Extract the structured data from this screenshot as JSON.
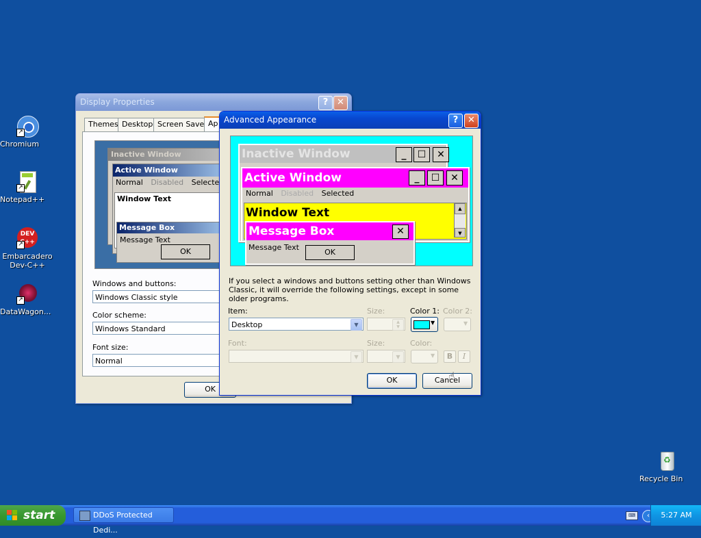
{
  "desktop_icons": [
    {
      "label": "Chromium",
      "icon": "chromium-icon"
    },
    {
      "label": "Notepad++",
      "icon": "notepadpp-icon"
    },
    {
      "label": "Embarcadero Dev-C++",
      "icon": "devcpp-icon"
    },
    {
      "label": "DataWagon...",
      "icon": "datawagon-icon"
    },
    {
      "label": "Recycle Bin",
      "icon": "recycle-bin-icon"
    }
  ],
  "display_properties": {
    "title": "Display Properties",
    "tabs": [
      "Themes",
      "Desktop",
      "Screen Saver",
      "Ap"
    ],
    "preview": {
      "inactive_title": "Inactive Window",
      "active_title": "Active Window",
      "menu": [
        "Normal",
        "Disabled",
        "Selected"
      ],
      "window_text": "Window Text",
      "msgbox_title": "Message Box",
      "msgbox_text": "Message Text",
      "ok": "OK"
    },
    "windows_buttons_label": "Windows and buttons:",
    "windows_buttons_value": "Windows Classic style",
    "color_scheme_label": "Color scheme:",
    "color_scheme_value": "Windows Standard",
    "font_size_label": "Font size:",
    "font_size_value": "Normal",
    "ok_button": "OK"
  },
  "advanced_appearance": {
    "title": "Advanced Appearance",
    "preview": {
      "inactive_title": "Inactive Window",
      "active_title": "Active Window",
      "menu": [
        "Normal",
        "Disabled",
        "Selected"
      ],
      "window_text": "Window Text",
      "msgbox_title": "Message Box",
      "msgbox_text": "Message Text",
      "ok": "OK"
    },
    "note": "If you select a windows and buttons setting other than Windows Classic, it will override the following settings, except in some older programs.",
    "item_label": "Item:",
    "item_value": "Desktop",
    "size_label": "Size:",
    "color1_label": "Color 1:",
    "color2_label": "Color 2:",
    "font_label": "Font:",
    "font_size_label": "Size:",
    "font_color_label": "Color:",
    "bold_label": "B",
    "italic_label": "I",
    "ok_button": "OK",
    "cancel_button": "Cancel",
    "color1_swatch": "#00ffff"
  },
  "taskbar": {
    "start_label": "start",
    "task_label": "DDoS Protected Dedi...",
    "clock": "5:27 AM"
  },
  "colors": {
    "desktop": "#0f4f9f",
    "preview_bg": "#00ffff",
    "active_caption": "#ff00ff",
    "window_bg": "#ffff00"
  }
}
